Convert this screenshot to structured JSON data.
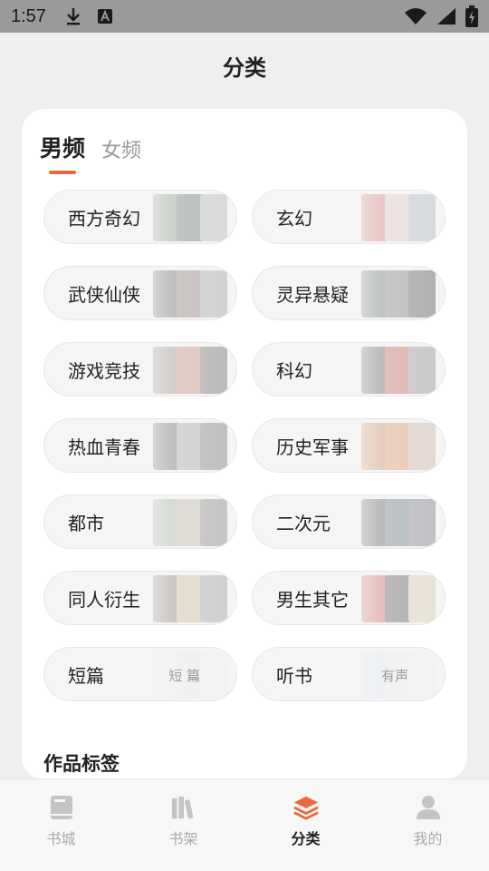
{
  "status_bar": {
    "time": "1:57",
    "icons": [
      "download-icon",
      "a-keyboard-icon",
      "wifi-icon",
      "signal-icon",
      "battery-charging-icon"
    ]
  },
  "header": {
    "title": "分类"
  },
  "gender_tabs": [
    {
      "label": "男频",
      "active": true
    },
    {
      "label": "女频",
      "active": false
    }
  ],
  "categories": [
    {
      "label": "西方奇幻",
      "cover_colors": [
        "#6c7c6a",
        "#3f4b4e",
        "#a0a6a0"
      ]
    },
    {
      "label": "玄幻",
      "cover_colors": [
        "#c8544e",
        "#d9b7b4",
        "#9aa6b4"
      ]
    },
    {
      "label": "武侠仙侠",
      "cover_colors": [
        "#3b3b3b",
        "#6b5b50",
        "#8f8f8f"
      ]
    },
    {
      "label": "灵异悬疑",
      "cover_colors": [
        "#3a4a3c",
        "#5a5a5a",
        "#2f2f2f"
      ]
    },
    {
      "label": "游戏竞技",
      "cover_colors": [
        "#7a6a62",
        "#b86a5a",
        "#4a4a4a"
      ]
    },
    {
      "label": "科幻",
      "cover_colors": [
        "#2f2f2f",
        "#b83a2a",
        "#7a7a7a"
      ]
    },
    {
      "label": "热血青春",
      "cover_colors": [
        "#3a3a3a",
        "#8a8a8a",
        "#5a5a5a"
      ]
    },
    {
      "label": "历史军事",
      "cover_colors": [
        "#c86a3a",
        "#d47a3a",
        "#c0a090"
      ]
    },
    {
      "label": "都市",
      "cover_colors": [
        "#8a9a8a",
        "#b0a090",
        "#6a6a6a"
      ]
    },
    {
      "label": "二次元",
      "cover_colors": [
        "#2a2a2a",
        "#3a4a5a",
        "#5a5a6a"
      ]
    },
    {
      "label": "同人衍生",
      "cover_colors": [
        "#6a5a4a",
        "#c0a878",
        "#8a8a8a"
      ]
    },
    {
      "label": "男生其它",
      "cover_colors": [
        "#c83a3a",
        "#2a2a2a",
        "#d0c0a0"
      ]
    },
    {
      "label": "短篇",
      "cover_text": "短 篇",
      "cover_colors": [
        "#f0f0f0",
        "#e8e8e8",
        "#f0f0f0"
      ]
    },
    {
      "label": "听书",
      "cover_text": "有声",
      "cover_colors": [
        "#e0e8f0",
        "#e8eef4",
        "#f0f0f0"
      ]
    }
  ],
  "section": {
    "title": "作品标签"
  },
  "bottom_nav": [
    {
      "label": "书城",
      "icon": "book-icon",
      "active": false
    },
    {
      "label": "书架",
      "icon": "bookshelf-icon",
      "active": false
    },
    {
      "label": "分类",
      "icon": "layers-icon",
      "active": true
    },
    {
      "label": "我的",
      "icon": "person-icon",
      "active": false
    }
  ],
  "colors": {
    "accent": "#e86a3c",
    "inactive": "#aaaaaa"
  }
}
